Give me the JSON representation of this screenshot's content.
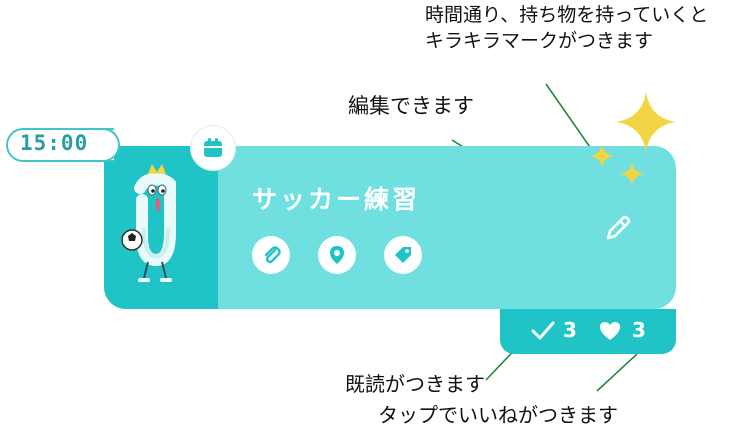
{
  "annotations": {
    "sparkle_line1": "時間通り、持ち物を持っていくと",
    "sparkle_line2": "キラキラマークがつきます",
    "edit": "編集できます",
    "read": "既読がつきます",
    "like": "タップでいいねがつきます"
  },
  "event": {
    "time": "15:00",
    "title": "サッカー練習",
    "read_count": "3",
    "like_count": "3"
  },
  "icons": {
    "calendar": "calendar-icon",
    "attachment": "paperclip-icon",
    "location": "map-pin-icon",
    "tag": "tag-icon",
    "edit": "pencil-icon",
    "read": "check-icon",
    "like": "heart-icon",
    "sparkle": "sparkle-icon"
  },
  "colors": {
    "card": "#6fdfe0",
    "accent": "#20c4c6",
    "time_text": "#2a9ea3",
    "sparkle": "#f2d544"
  }
}
